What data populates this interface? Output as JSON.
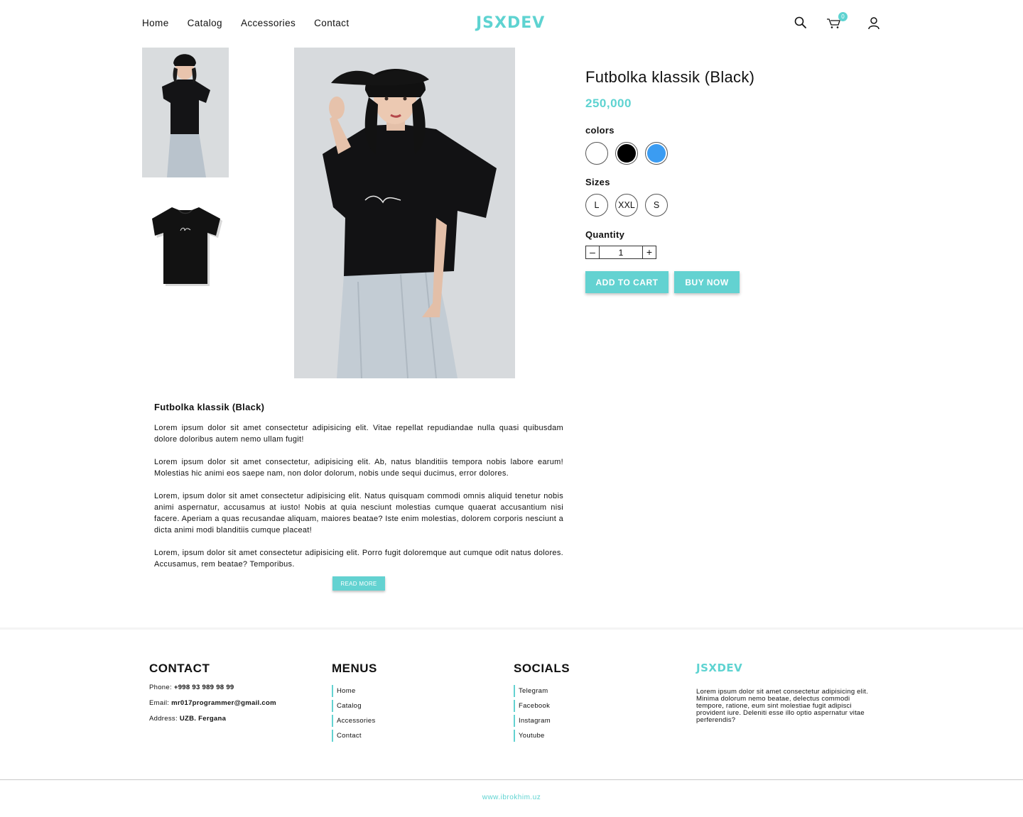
{
  "header": {
    "nav": [
      "Home",
      "Catalog",
      "Accessories",
      "Contact"
    ],
    "logo": "JSXDEV",
    "cart_count": "0",
    "icons": [
      "search-icon",
      "cart-icon",
      "user-icon"
    ]
  },
  "product": {
    "title": "Futbolka klassik (Black)",
    "price": "250,000",
    "colors_label": "colors",
    "colors": [
      "#ffffff",
      "#000000",
      "#3b9cf2"
    ],
    "sizes_label": "Sizes",
    "sizes": [
      "L",
      "XXL",
      "S"
    ],
    "quantity_label": "Quantity",
    "quantity": "1",
    "add_to_cart": "ADD TO CART",
    "buy_now": "BUY NOW"
  },
  "description": {
    "title": "Futbolka klassik (Black)",
    "paragraphs": [
      "Lorem ipsum dolor sit amet consectetur adipisicing elit. Vitae repellat repudiandae nulla quasi quibusdam dolore doloribus autem nemo ullam fugit!",
      "Lorem ipsum dolor sit amet consectetur, adipisicing elit. Ab, natus blanditiis tempora nobis labore earum! Molestias hic animi eos saepe nam, non dolor dolorum, nobis unde sequi ducimus, error dolores.",
      "Lorem, ipsum dolor sit amet consectetur adipisicing elit. Natus quisquam commodi omnis aliquid tenetur nobis animi aspernatur, accusamus at iusto! Nobis at quia nesciunt molestias cumque quaerat accusantium nisi facere. Aperiam a quas recusandae aliquam, maiores beatae? Iste enim molestias, dolorem corporis nesciunt a dicta animi modi blanditiis cumque placeat!",
      "Lorem, ipsum dolor sit amet consectetur adipisicing elit. Porro fugit doloremque aut cumque odit natus dolores. Accusamus, rem beatae? Temporibus."
    ],
    "read_more": "READ MORE"
  },
  "footer": {
    "contact": {
      "heading": "CONTACT",
      "phone_label": "Phone:",
      "phone": "+998 93 989 98 99",
      "email_label": "Email:",
      "email": "mr017programmer@gmail.com",
      "address_label": "Address:",
      "address": "UZB. Fergana"
    },
    "menus": {
      "heading": "MENUS",
      "items": [
        "Home",
        "Catalog",
        "Accessories",
        "Contact"
      ]
    },
    "socials": {
      "heading": "SOCIALS",
      "items": [
        "Telegram",
        "Facebook",
        "Instagram",
        "Youtube"
      ]
    },
    "brand": {
      "logo": "JSXDEV",
      "about": "Lorem ipsum dolor sit amet consectetur adipisicing elit. Minima dolorum nemo beatae, delectus commodi tempore, ratione, eum sint molestiae fugit adipisci provident iure. Deleniti esse illo optio aspernatur vitae perferendis?"
    },
    "site": "www.ibrokhim.uz"
  },
  "accent_color": "#5ed3d1"
}
